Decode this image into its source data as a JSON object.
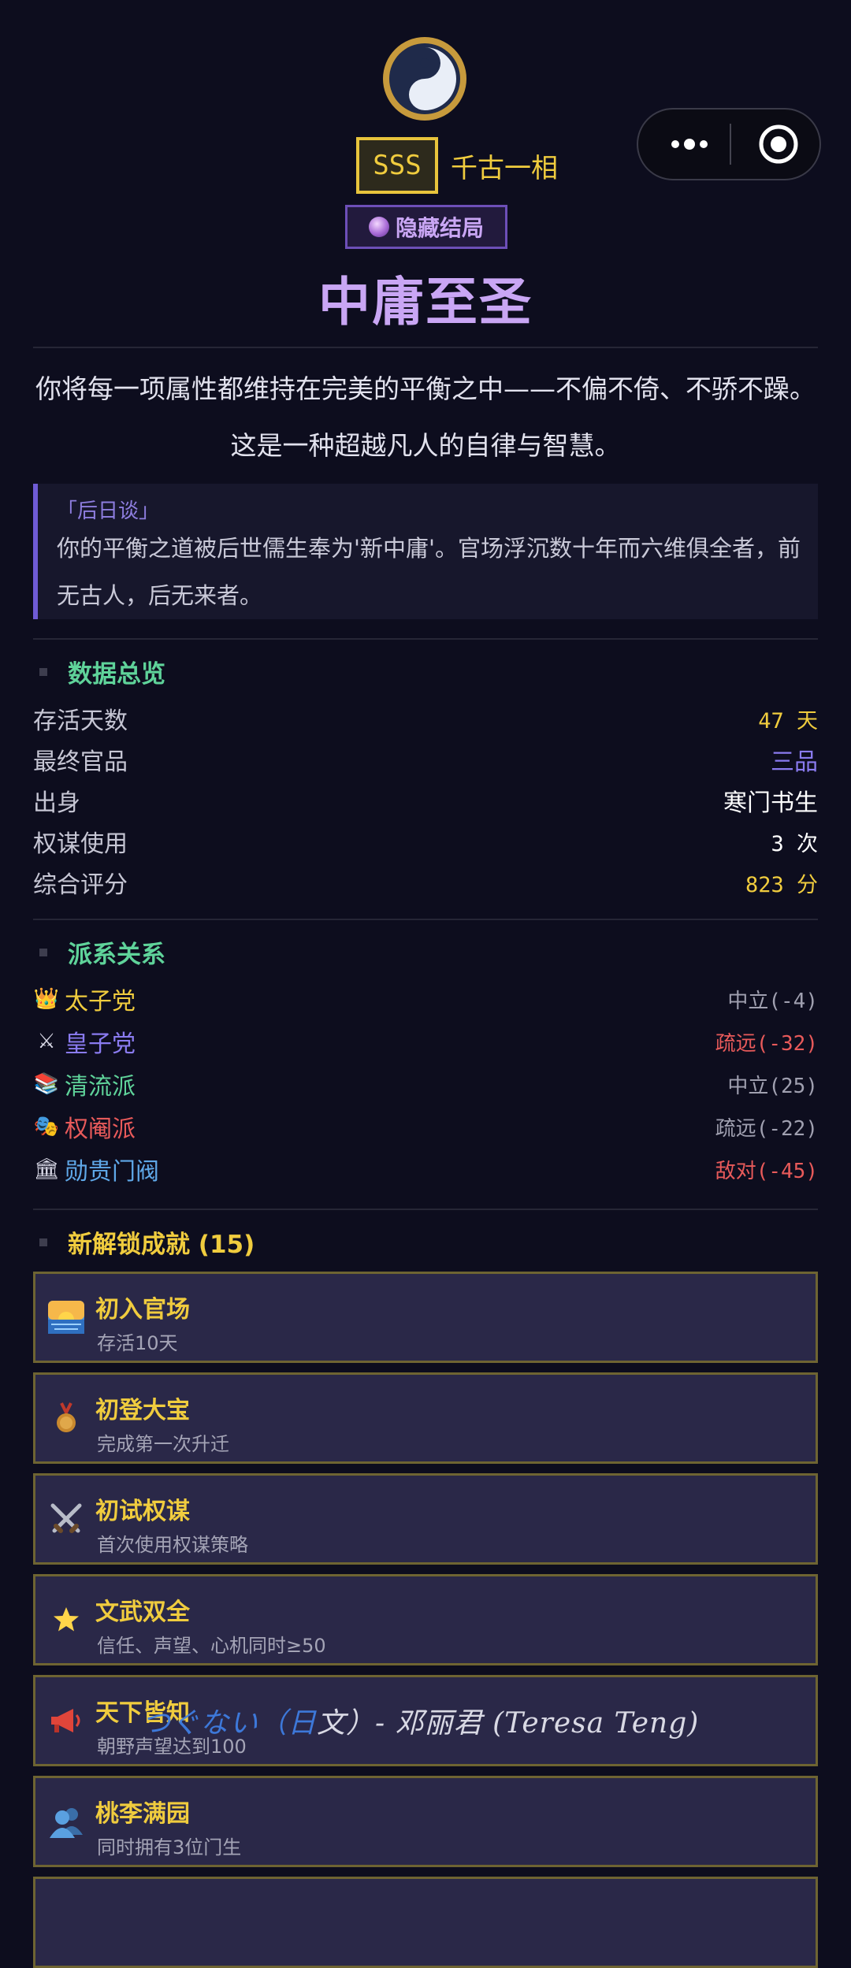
{
  "header": {
    "rank_grade": "SSS",
    "rank_title": "千古一相",
    "ending_badge": "隐藏结局",
    "ending_title": "中庸至圣",
    "description": "你将每一项属性都维持在完美的平衡之中——不偏不倚、不骄不躁。这是一种超越凡人的自律与智慧。",
    "epilogue_label": "「后日谈」",
    "epilogue_text": "你的平衡之道被后世儒生奉为'新中庸'。官场浮沉数十年而六维俱全者，前无古人，后无来者。"
  },
  "overview": {
    "title": "数据总览",
    "rows": [
      {
        "label": "存活天数",
        "value": "47 天",
        "color": "#f0cc3e"
      },
      {
        "label": "最终官品",
        "value": "三品",
        "color": "#8a7bf0"
      },
      {
        "label": "出身",
        "value": "寒门书生",
        "color": "#ffffff"
      },
      {
        "label": "权谋使用",
        "value": "3 次",
        "color": "#ffffff"
      },
      {
        "label": "综合评分",
        "value": "823 分",
        "color": "#f0cc3e"
      }
    ]
  },
  "factions": {
    "title": "派系关系",
    "rows": [
      {
        "icon": "crown-icon",
        "name": "太子党",
        "name_color": "#f0cc3e",
        "status": "中立(-4)",
        "status_color": "#a0a0b0"
      },
      {
        "icon": "crossed-swords-icon",
        "name": "皇子党",
        "name_color": "#8a7bf0",
        "status": "疏远(-32)",
        "status_color": "#e85a5a"
      },
      {
        "icon": "books-icon",
        "name": "清流派",
        "name_color": "#5fd39a",
        "status": "中立(25)",
        "status_color": "#a0a0b0"
      },
      {
        "icon": "theater-masks-icon",
        "name": "权阉派",
        "name_color": "#e85a5a",
        "status": "疏远(-22)",
        "status_color": "#a0a0b0"
      },
      {
        "icon": "classical-building-icon",
        "name": "勋贵门阀",
        "name_color": "#5fa8e8",
        "status": "敌对(-45)",
        "status_color": "#e85a5a"
      }
    ]
  },
  "achievements": {
    "title": "新解锁成就 (15)",
    "items": [
      {
        "icon": "sunrise-icon",
        "title": "初入官场",
        "desc": "存活10天"
      },
      {
        "icon": "medal-icon",
        "title": "初登大宝",
        "desc": "完成第一次升迁"
      },
      {
        "icon": "crossed-swords-icon",
        "title": "初试权谋",
        "desc": "首次使用权谋策略"
      },
      {
        "icon": "star-icon",
        "title": "文武双全",
        "desc": "信任、声望、心机同时≥50"
      },
      {
        "icon": "megaphone-icon",
        "title": "天下皆知",
        "desc": "朝野声望达到100"
      },
      {
        "icon": "people-icon",
        "title": "桃李满园",
        "desc": "同时拥有3位门生"
      }
    ]
  },
  "overlay": {
    "lyric_blue": "つぐない（日",
    "lyric_white": "文）- 邓丽君 (Teresa Teng)"
  },
  "colors": {
    "background": "#0d0d1e",
    "gold": "#f0cc3e",
    "purple": "#c9a6f4",
    "green": "#5fd39a",
    "red": "#e85a5a"
  }
}
